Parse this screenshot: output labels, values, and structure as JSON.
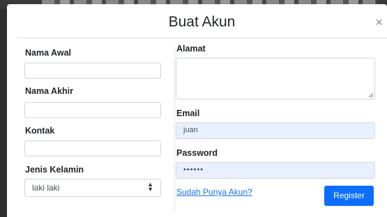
{
  "modal": {
    "title": "Buat Akun",
    "close_glyph": "×",
    "close_icon": "close-icon"
  },
  "left": {
    "first_name": {
      "label": "Nama Awal",
      "value": ""
    },
    "last_name": {
      "label": "Nama Akhir",
      "value": ""
    },
    "contact": {
      "label": "Kontak",
      "value": ""
    },
    "gender": {
      "label": "Jenis Kelamin",
      "selected": "laki laki",
      "arrow_icon": "select-arrows-icon"
    }
  },
  "right": {
    "address": {
      "label": "Alamat",
      "value": ""
    },
    "email": {
      "label": "Email",
      "value": "juan"
    },
    "password": {
      "label": "Password",
      "value": "••••••"
    },
    "login_link": "Sudah Punya Akun?",
    "register_button": "Register"
  },
  "colors": {
    "primary": "#0d6efd",
    "link": "#1a73e8",
    "autofill": "#e8f0fe"
  }
}
